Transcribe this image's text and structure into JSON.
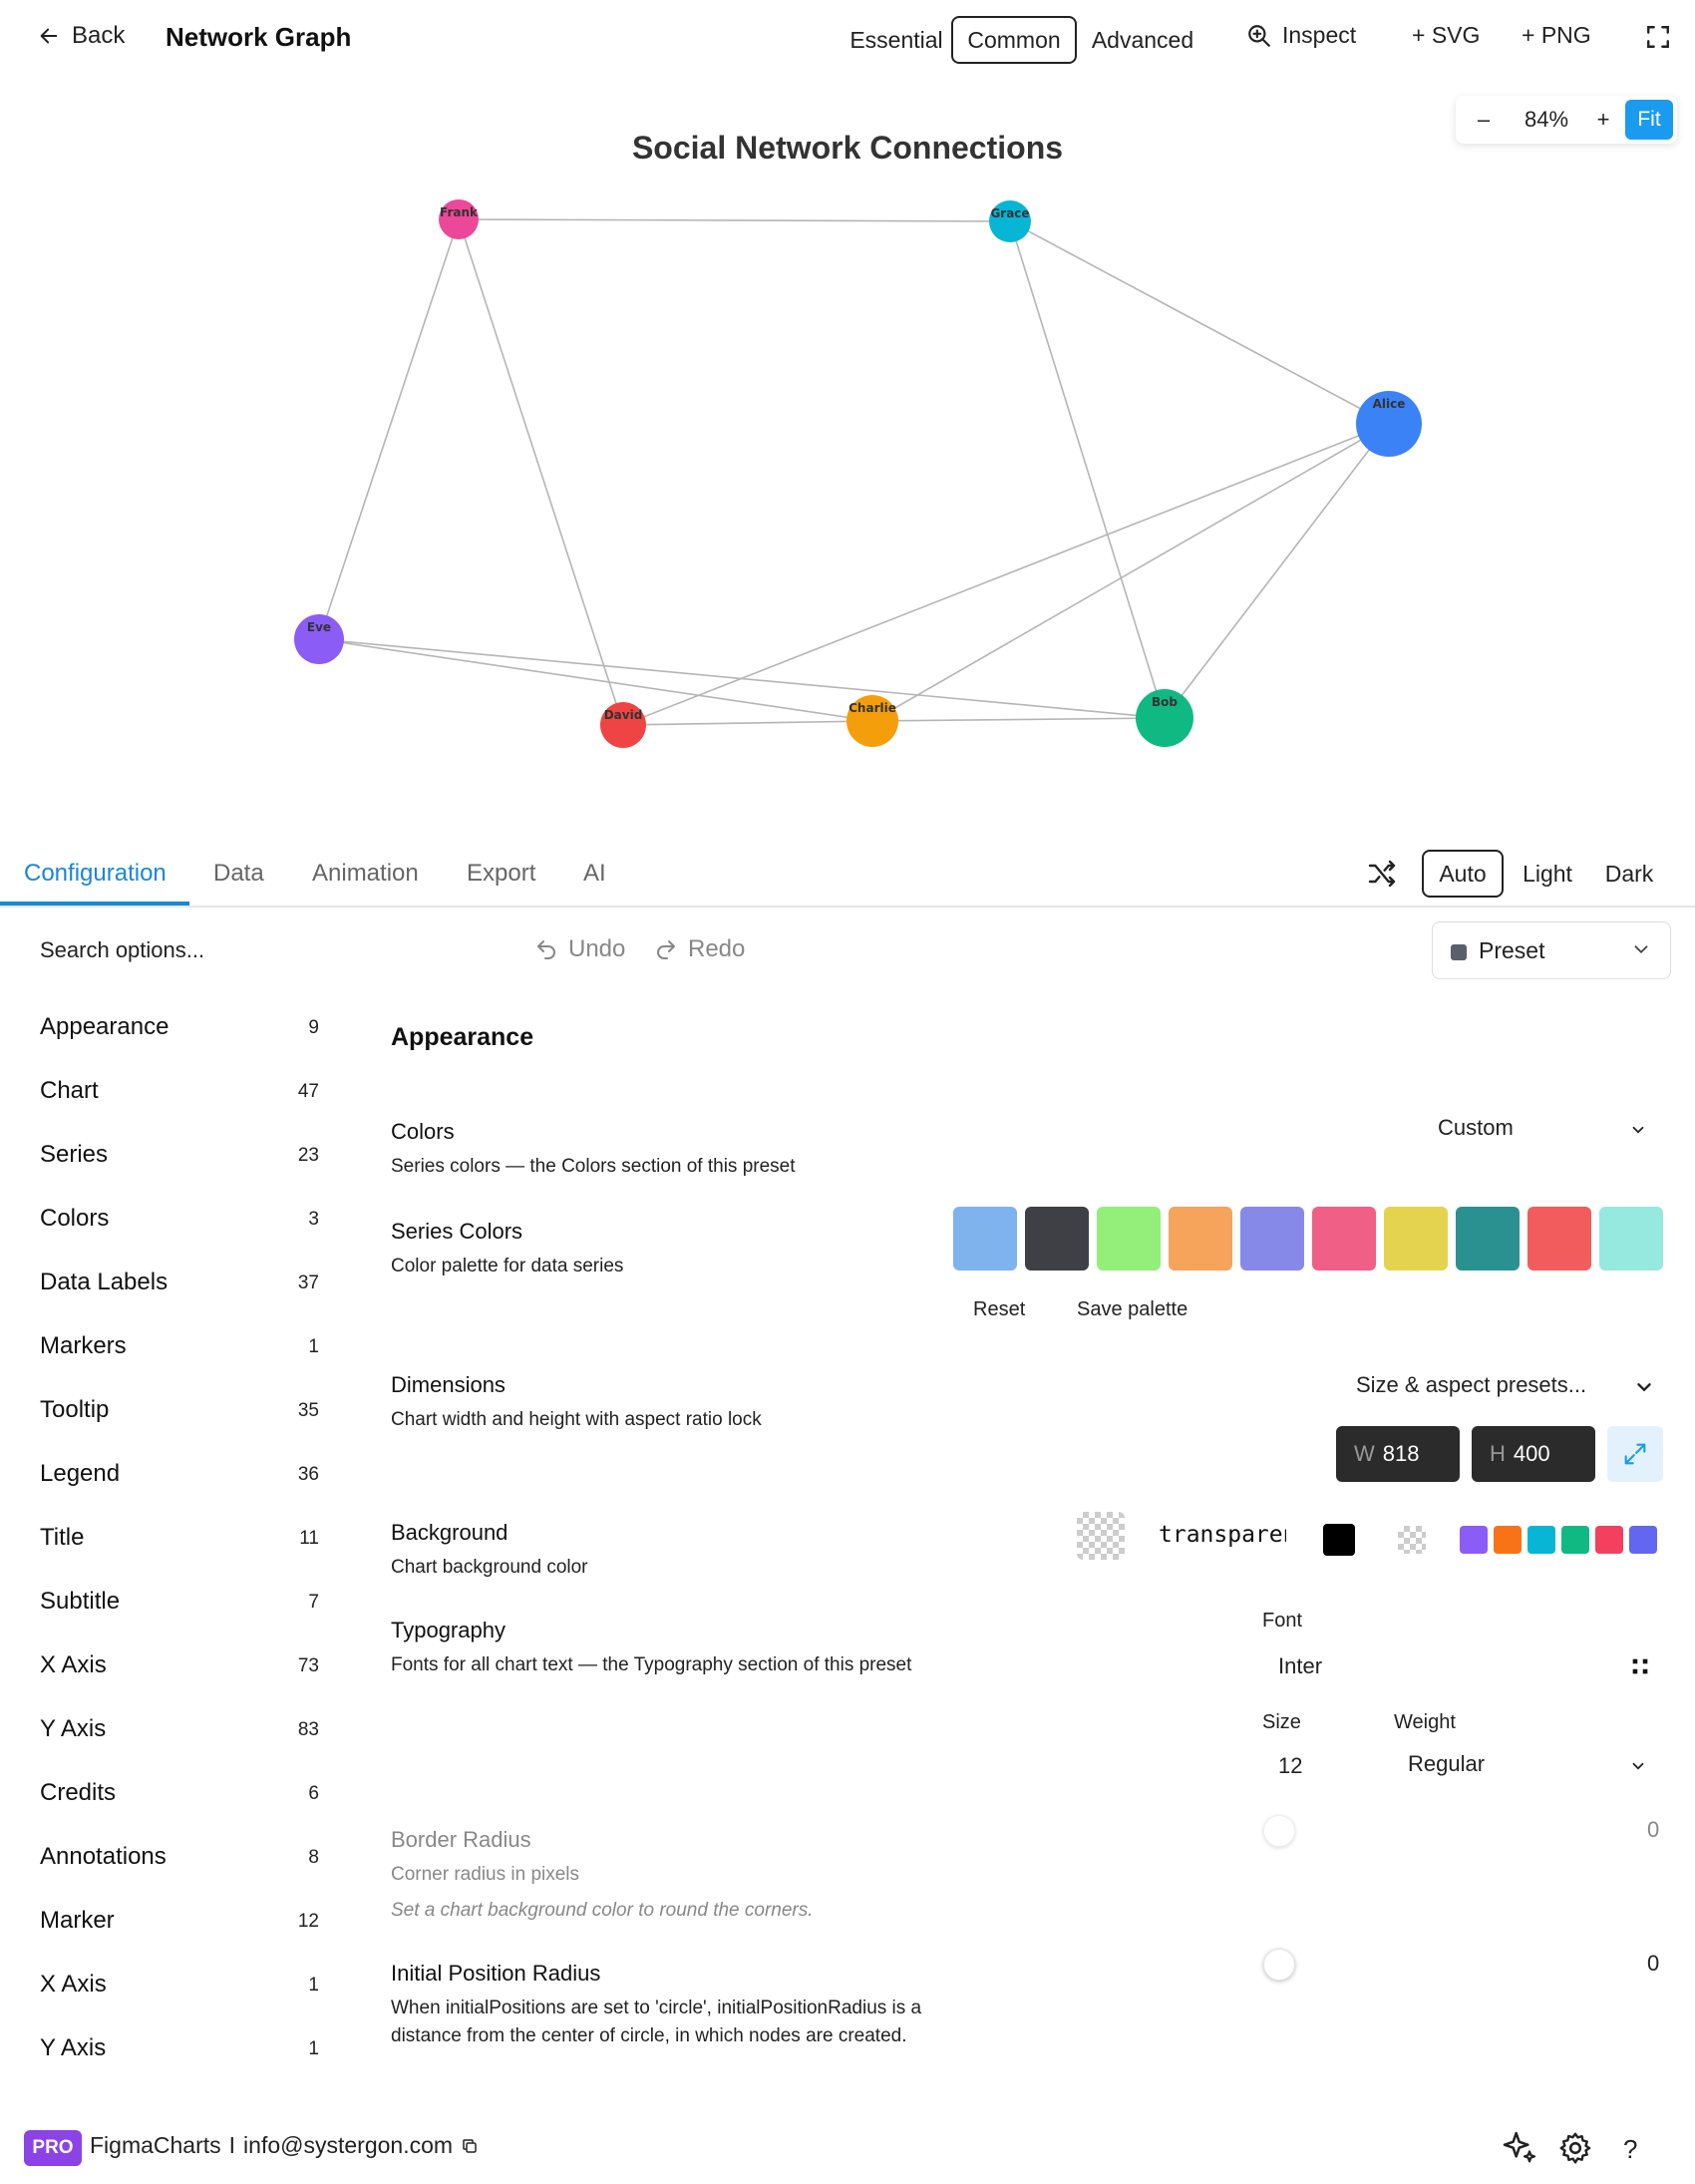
{
  "header": {
    "back_label": "Back",
    "title": "Network Graph",
    "modes": [
      "Essential",
      "Common",
      "Advanced"
    ],
    "active_mode": "Common",
    "inspect_label": "Inspect",
    "svg_label": "+ SVG",
    "png_label": "+ PNG"
  },
  "zoom": {
    "minus": "–",
    "value": "84%",
    "plus": "+",
    "fit": "Fit"
  },
  "chart_data": {
    "type": "network",
    "title": "Social Network Connections",
    "nodes": [
      {
        "name": "Frank",
        "color": "#ec4899"
      },
      {
        "name": "Grace",
        "color": "#06b6d4"
      },
      {
        "name": "Alice",
        "color": "#3b82f6"
      },
      {
        "name": "Eve",
        "color": "#8b5cf6"
      },
      {
        "name": "David",
        "color": "#ef4444"
      },
      {
        "name": "Charlie",
        "color": "#f59e0b"
      },
      {
        "name": "Bob",
        "color": "#10b981"
      }
    ],
    "edges": [
      [
        "Frank",
        "Grace"
      ],
      [
        "Frank",
        "Eve"
      ],
      [
        "Frank",
        "David"
      ],
      [
        "Grace",
        "Alice"
      ],
      [
        "Grace",
        "Bob"
      ],
      [
        "Alice",
        "David"
      ],
      [
        "Alice",
        "Charlie"
      ],
      [
        "Alice",
        "Bob"
      ],
      [
        "Eve",
        "Charlie"
      ],
      [
        "Eve",
        "Bob"
      ],
      [
        "David",
        "Charlie"
      ],
      [
        "Charlie",
        "Bob"
      ]
    ]
  },
  "tabs": [
    "Configuration",
    "Data",
    "Animation",
    "Export",
    "AI"
  ],
  "active_tab": "Configuration",
  "theme": {
    "modes": [
      "Auto",
      "Light",
      "Dark"
    ],
    "active": "Auto"
  },
  "toolbar": {
    "search_placeholder": "Search options...",
    "undo": "Undo",
    "redo": "Redo",
    "preset": "Preset"
  },
  "sidebar": {
    "items": [
      {
        "label": "Appearance",
        "count": "9"
      },
      {
        "label": "Chart",
        "count": "47"
      },
      {
        "label": "Series",
        "count": "23"
      },
      {
        "label": "Colors",
        "count": "3"
      },
      {
        "label": "Data Labels",
        "count": "37"
      },
      {
        "label": "Markers",
        "count": "1"
      },
      {
        "label": "Tooltip",
        "count": "35"
      },
      {
        "label": "Legend",
        "count": "36"
      },
      {
        "label": "Title",
        "count": "11"
      },
      {
        "label": "Subtitle",
        "count": "7"
      },
      {
        "label": "X Axis",
        "count": "73"
      },
      {
        "label": "Y Axis",
        "count": "83"
      },
      {
        "label": "Credits",
        "count": "6"
      },
      {
        "label": "Annotations",
        "count": "8"
      },
      {
        "label": "Marker",
        "count": "12"
      },
      {
        "label": "X Axis",
        "count": "1"
      },
      {
        "label": "Y Axis",
        "count": "1"
      }
    ]
  },
  "panel": {
    "section_title": "Appearance",
    "colors": {
      "label": "Colors",
      "desc": "Series colors — the Colors section of this preset",
      "value": "Custom"
    },
    "series_colors": {
      "label": "Series Colors",
      "desc": "Color palette for data series",
      "swatches": [
        "#7fb3ee",
        "#3f3f46",
        "#93ee7a",
        "#f6a45c",
        "#8789e9",
        "#ef5f86",
        "#e4d34f",
        "#2b9190",
        "#f25c5c",
        "#96e9df"
      ],
      "reset": "Reset",
      "save": "Save palette"
    },
    "dimensions": {
      "label": "Dimensions",
      "desc": "Chart width and height with aspect ratio lock",
      "presets": "Size & aspect presets...",
      "w_prefix": "W",
      "w": "818",
      "h_prefix": "H",
      "h": "400"
    },
    "background": {
      "label": "Background",
      "desc": "Chart background color",
      "value": "transparent",
      "quick": [
        "#8b5cf6",
        "#f97316",
        "#06b6d4",
        "#10b981",
        "#f43f5e",
        "#6366f1"
      ]
    },
    "typography": {
      "label": "Typography",
      "desc": "Fonts for all chart text — the Typography section of this preset",
      "font_label": "Font",
      "font": "Inter",
      "size_label": "Size",
      "size": "12",
      "weight_label": "Weight",
      "weight": "Regular"
    },
    "border_radius": {
      "label": "Border Radius",
      "desc": "Corner radius in pixels",
      "note": "Set a chart background color to round the corners.",
      "value": "0"
    },
    "initial_radius": {
      "label": "Initial Position Radius",
      "desc1": "When initialPositions are set to 'circle', initialPositionRadius is a",
      "desc2": "distance from the center of circle, in which nodes are created.",
      "value": "0"
    }
  },
  "footer": {
    "badge": "PRO",
    "brand": "FigmaCharts",
    "sep": "I",
    "email": "info@systergon.com",
    "help": "?"
  }
}
